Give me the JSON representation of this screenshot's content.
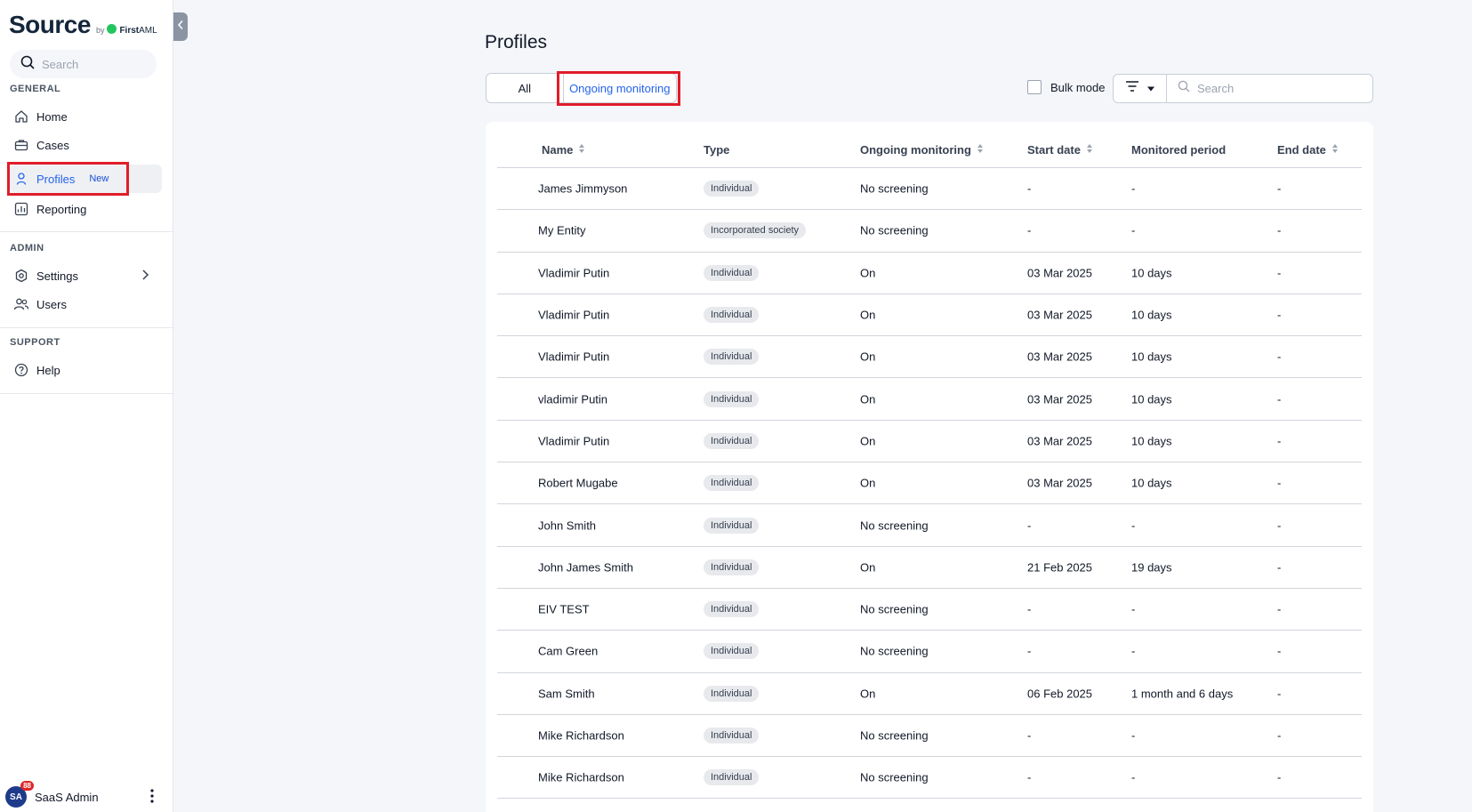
{
  "sidebar": {
    "logo": {
      "name": "Source",
      "by": "by",
      "brand_bold": "First",
      "brand_light": "AML"
    },
    "search": {
      "placeholder": "Search"
    },
    "sections": {
      "general": "GENERAL",
      "admin": "ADMIN",
      "support": "SUPPORT"
    },
    "items": {
      "home": "Home",
      "cases": "Cases",
      "profiles": "Profiles",
      "profiles_badge": "New",
      "reporting": "Reporting",
      "settings": "Settings",
      "users": "Users",
      "help": "Help"
    },
    "user": {
      "initials": "SA",
      "notifications": "88",
      "name": "SaaS Admin"
    }
  },
  "main": {
    "title": "Profiles",
    "tabs": {
      "all": "All",
      "ongoing": "Ongoing monitoring"
    },
    "bulk_mode": "Bulk mode",
    "search": {
      "placeholder": "Search"
    },
    "table": {
      "headers": {
        "name": "Name",
        "type": "Type",
        "monitoring": "Ongoing monitoring",
        "start": "Start date",
        "period": "Monitored period",
        "end": "End date"
      },
      "rows": [
        {
          "name": "James Jimmyson",
          "type": "Individual",
          "monitoring": "No screening",
          "start": "-",
          "period": "-",
          "end": "-"
        },
        {
          "name": "My Entity",
          "type": "Incorporated society",
          "monitoring": "No screening",
          "start": "-",
          "period": "-",
          "end": "-"
        },
        {
          "name": "Vladimir Putin",
          "type": "Individual",
          "monitoring": "On",
          "start": "03 Mar 2025",
          "period": "10 days",
          "end": "-"
        },
        {
          "name": "Vladimir Putin",
          "type": "Individual",
          "monitoring": "On",
          "start": "03 Mar 2025",
          "period": "10 days",
          "end": "-"
        },
        {
          "name": "Vladimir Putin",
          "type": "Individual",
          "monitoring": "On",
          "start": "03 Mar 2025",
          "period": "10 days",
          "end": "-"
        },
        {
          "name": "vladimir Putin",
          "type": "Individual",
          "monitoring": "On",
          "start": "03 Mar 2025",
          "period": "10 days",
          "end": "-"
        },
        {
          "name": "Vladimir Putin",
          "type": "Individual",
          "monitoring": "On",
          "start": "03 Mar 2025",
          "period": "10 days",
          "end": "-"
        },
        {
          "name": "Robert Mugabe",
          "type": "Individual",
          "monitoring": "On",
          "start": "03 Mar 2025",
          "period": "10 days",
          "end": "-"
        },
        {
          "name": "John Smith",
          "type": "Individual",
          "monitoring": "No screening",
          "start": "-",
          "period": "-",
          "end": "-"
        },
        {
          "name": "John James Smith",
          "type": "Individual",
          "monitoring": "On",
          "start": "21 Feb 2025",
          "period": "19 days",
          "end": "-"
        },
        {
          "name": "EIV TEST",
          "type": "Individual",
          "monitoring": "No screening",
          "start": "-",
          "period": "-",
          "end": "-"
        },
        {
          "name": "Cam Green",
          "type": "Individual",
          "monitoring": "No screening",
          "start": "-",
          "period": "-",
          "end": "-"
        },
        {
          "name": "Sam Smith",
          "type": "Individual",
          "monitoring": "On",
          "start": "06 Feb 2025",
          "period": "1 month and 6 days",
          "end": "-"
        },
        {
          "name": "Mike Richardson",
          "type": "Individual",
          "monitoring": "No screening",
          "start": "-",
          "period": "-",
          "end": "-"
        },
        {
          "name": "Mike Richardson",
          "type": "Individual",
          "monitoring": "No screening",
          "start": "-",
          "period": "-",
          "end": "-"
        }
      ]
    }
  },
  "colors": {
    "accent": "#2563eb",
    "highlight": "#e11d2a",
    "brand_green": "#22c55e",
    "logo_navy": "#14263a"
  }
}
